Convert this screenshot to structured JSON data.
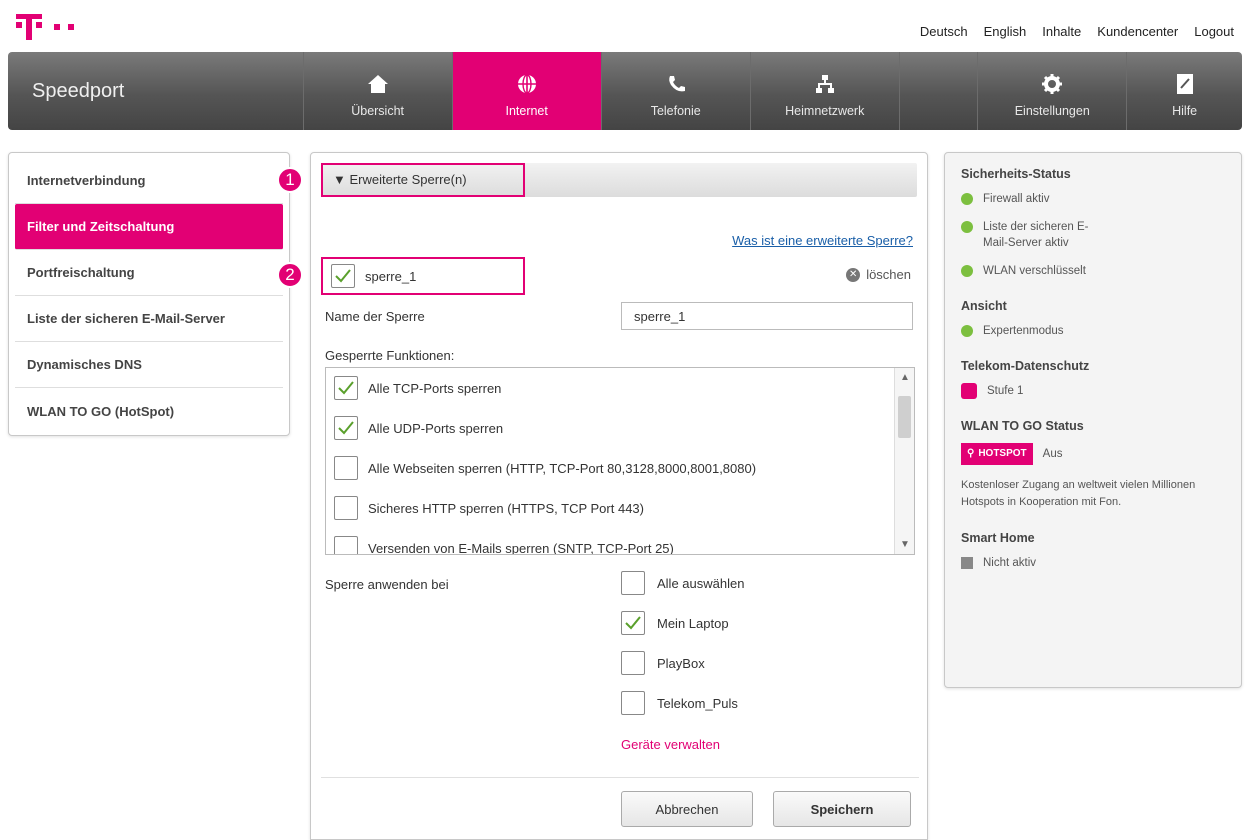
{
  "top_links": [
    "Deutsch",
    "English",
    "Inhalte",
    "Kundencenter",
    "Logout"
  ],
  "brand": "Speedport",
  "nav": [
    {
      "label": "Übersicht",
      "icon": "home-icon"
    },
    {
      "label": "Internet",
      "icon": "globe-icon",
      "active": true
    },
    {
      "label": "Telefonie",
      "icon": "phone-icon"
    },
    {
      "label": "Heimnetzwerk",
      "icon": "network-icon"
    },
    {
      "label": "Einstellungen",
      "icon": "gear-icon"
    },
    {
      "label": "Hilfe",
      "icon": "help-book-icon"
    }
  ],
  "sidebar": [
    "Internetverbindung",
    "Filter und Zeitschaltung",
    "Portfreischaltung",
    "Liste der sicheren E-Mail-Server",
    "Dynamisches DNS",
    "WLAN TO GO (HotSpot)"
  ],
  "badges": [
    "1",
    "2"
  ],
  "section_title": "Erweiterte Sperre(n)",
  "what_link": "Was ist eine erweiterte Sperre?",
  "rule_name": "sperre_1",
  "delete_label": "löschen",
  "name_label": "Name der Sperre",
  "name_value": "sperre_1",
  "functions_label": "Gesperrte Funktionen:",
  "functions": [
    {
      "label": "Alle TCP-Ports sperren",
      "checked": true
    },
    {
      "label": "Alle UDP-Ports sperren",
      "checked": true
    },
    {
      "label": "Alle Webseiten sperren (HTTP, TCP-Port 80,3128,8000,8001,8080)",
      "checked": false
    },
    {
      "label": "Sicheres HTTP sperren (HTTPS, TCP Port 443)",
      "checked": false
    },
    {
      "label": "Versenden von E-Mails sperren (SNTP, TCP-Port 25)",
      "checked": false
    }
  ],
  "apply_label": "Sperre anwenden bei",
  "devices": [
    {
      "label": "Alle auswählen",
      "checked": false
    },
    {
      "label": "Mein Laptop",
      "checked": true
    },
    {
      "label": "PlayBox",
      "checked": false
    },
    {
      "label": "Telekom_Puls",
      "checked": false
    }
  ],
  "manage_devices": "Geräte verwalten",
  "cancel_label": "Abbrechen",
  "save_label": "Speichern",
  "right": {
    "security_title": "Sicherheits-Status",
    "security_items": [
      "Firewall aktiv",
      "Liste der sicheren E-Mail-Server aktiv",
      "WLAN verschlüsselt"
    ],
    "view_title": "Ansicht",
    "view_item": "Expertenmodus",
    "privacy_title": "Telekom-Datenschutz",
    "privacy_item": "Stufe 1",
    "wlan_title": "WLAN TO GO Status",
    "hotspot_label": "HOTSPOT",
    "hotspot_status": "Aus",
    "wlan_desc": "Kostenloser Zugang an weltweit vielen Millionen Hotspots in Kooperation mit Fon.",
    "smarthome_title": "Smart Home",
    "smarthome_item": "Nicht aktiv"
  },
  "colors": {
    "magenta": "#e20074",
    "status_green": "#7cbf3f",
    "link_blue": "#1a5fa8"
  }
}
